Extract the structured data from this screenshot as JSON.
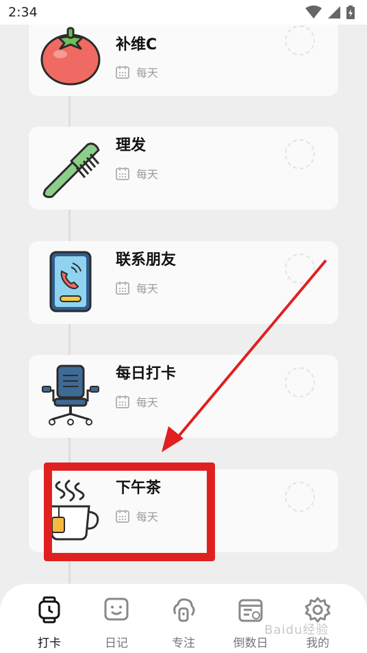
{
  "status_bar": {
    "time": "2:34"
  },
  "habits": [
    {
      "title": "补维C",
      "frequency": "每天",
      "icon": "tomato-icon"
    },
    {
      "title": "理发",
      "frequency": "每天",
      "icon": "comb-icon"
    },
    {
      "title": "联系朋友",
      "frequency": "每天",
      "icon": "phone-call-icon"
    },
    {
      "title": "每日打卡",
      "frequency": "每天",
      "icon": "office-chair-icon"
    },
    {
      "title": "下午茶",
      "frequency": "每天",
      "icon": "tea-cup-icon"
    }
  ],
  "tabs": [
    {
      "label": "打卡",
      "icon": "watch-icon",
      "active": true
    },
    {
      "label": "日记",
      "icon": "smile-note-icon",
      "active": false
    },
    {
      "label": "专注",
      "icon": "focus-timer-icon",
      "active": false
    },
    {
      "label": "倒数日",
      "icon": "calendar-countdown-icon",
      "active": false
    },
    {
      "label": "我的",
      "icon": "gear-icon",
      "active": false
    }
  ],
  "annotation": {
    "color": "#e02020"
  },
  "watermark": "Baidu经验"
}
